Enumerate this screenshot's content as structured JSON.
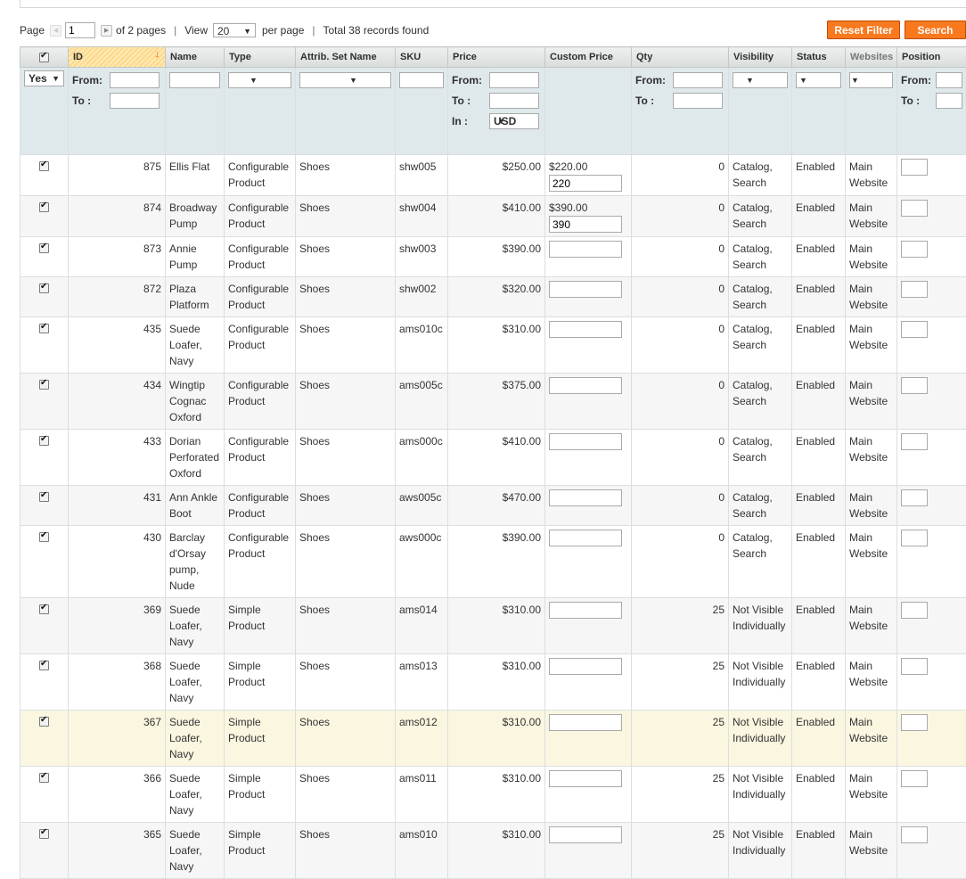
{
  "pager": {
    "page_label": "Page",
    "page_value": "1",
    "of_pages": "of 2 pages",
    "view_label": "View",
    "per_page_value": "20",
    "per_page_label": "per page",
    "total": "Total 38 records found"
  },
  "buttons": {
    "reset": "Reset Filter",
    "search": "Search"
  },
  "columns": [
    "ID",
    "Name",
    "Type",
    "Attrib. Set Name",
    "SKU",
    "Price",
    "Custom Price",
    "Qty",
    "Visibility",
    "Status",
    "Websites",
    "Position"
  ],
  "filter": {
    "in_products": "Yes",
    "from": "From:",
    "to": "To :",
    "in": "In :",
    "currency": "USD"
  },
  "rows": [
    {
      "id": "875",
      "name": "Ellis Flat",
      "type": "Configurable Product",
      "set": "Shoes",
      "sku": "shw005",
      "price": "$250.00",
      "custom_text": "$220.00",
      "custom_value": "220",
      "qty": "0",
      "visibility": "Catalog, Search",
      "status": "Enabled",
      "website": "Main Website"
    },
    {
      "id": "874",
      "name": "Broadway Pump",
      "type": "Configurable Product",
      "set": "Shoes",
      "sku": "shw004",
      "price": "$410.00",
      "custom_text": "$390.00",
      "custom_value": "390",
      "qty": "0",
      "visibility": "Catalog, Search",
      "status": "Enabled",
      "website": "Main Website"
    },
    {
      "id": "873",
      "name": "Annie Pump",
      "type": "Configurable Product",
      "set": "Shoes",
      "sku": "shw003",
      "price": "$390.00",
      "custom_text": "",
      "custom_value": "",
      "qty": "0",
      "visibility": "Catalog, Search",
      "status": "Enabled",
      "website": "Main Website"
    },
    {
      "id": "872",
      "name": "Plaza Platform",
      "type": "Configurable Product",
      "set": "Shoes",
      "sku": "shw002",
      "price": "$320.00",
      "custom_text": "",
      "custom_value": "",
      "qty": "0",
      "visibility": "Catalog, Search",
      "status": "Enabled",
      "website": "Main Website"
    },
    {
      "id": "435",
      "name": "Suede Loafer, Navy",
      "type": "Configurable Product",
      "set": "Shoes",
      "sku": "ams010c",
      "price": "$310.00",
      "custom_text": "",
      "custom_value": "",
      "qty": "0",
      "visibility": "Catalog, Search",
      "status": "Enabled",
      "website": "Main Website"
    },
    {
      "id": "434",
      "name": "Wingtip Cognac Oxford",
      "type": "Configurable Product",
      "set": "Shoes",
      "sku": "ams005c",
      "price": "$375.00",
      "custom_text": "",
      "custom_value": "",
      "qty": "0",
      "visibility": "Catalog, Search",
      "status": "Enabled",
      "website": "Main Website"
    },
    {
      "id": "433",
      "name": "Dorian Perforated Oxford",
      "type": "Configurable Product",
      "set": "Shoes",
      "sku": "ams000c",
      "price": "$410.00",
      "custom_text": "",
      "custom_value": "",
      "qty": "0",
      "visibility": "Catalog, Search",
      "status": "Enabled",
      "website": "Main Website"
    },
    {
      "id": "431",
      "name": "Ann Ankle Boot",
      "type": "Configurable Product",
      "set": "Shoes",
      "sku": "aws005c",
      "price": "$470.00",
      "custom_text": "",
      "custom_value": "",
      "qty": "0",
      "visibility": "Catalog, Search",
      "status": "Enabled",
      "website": "Main Website"
    },
    {
      "id": "430",
      "name": "Barclay d'Orsay pump, Nude",
      "type": "Configurable Product",
      "set": "Shoes",
      "sku": "aws000c",
      "price": "$390.00",
      "custom_text": "",
      "custom_value": "",
      "qty": "0",
      "visibility": "Catalog, Search",
      "status": "Enabled",
      "website": "Main Website"
    },
    {
      "id": "369",
      "name": "Suede Loafer, Navy",
      "type": "Simple Product",
      "set": "Shoes",
      "sku": "ams014",
      "price": "$310.00",
      "custom_text": "",
      "custom_value": "",
      "qty": "25",
      "visibility": "Not Visible Individually",
      "status": "Enabled",
      "website": "Main Website"
    },
    {
      "id": "368",
      "name": "Suede Loafer, Navy",
      "type": "Simple Product",
      "set": "Shoes",
      "sku": "ams013",
      "price": "$310.00",
      "custom_text": "",
      "custom_value": "",
      "qty": "25",
      "visibility": "Not Visible Individually",
      "status": "Enabled",
      "website": "Main Website"
    },
    {
      "id": "367",
      "name": "Suede Loafer, Navy",
      "type": "Simple Product",
      "set": "Shoes",
      "sku": "ams012",
      "price": "$310.00",
      "custom_text": "",
      "custom_value": "",
      "qty": "25",
      "visibility": "Not Visible Individually",
      "status": "Enabled",
      "website": "Main Website"
    },
    {
      "id": "366",
      "name": "Suede Loafer, Navy",
      "type": "Simple Product",
      "set": "Shoes",
      "sku": "ams011",
      "price": "$310.00",
      "custom_text": "",
      "custom_value": "",
      "qty": "25",
      "visibility": "Not Visible Individually",
      "status": "Enabled",
      "website": "Main Website"
    },
    {
      "id": "365",
      "name": "Suede Loafer, Navy",
      "type": "Simple Product",
      "set": "Shoes",
      "sku": "ams010",
      "price": "$310.00",
      "custom_text": "",
      "custom_value": "",
      "qty": "25",
      "visibility": "Not Visible Individually",
      "status": "Enabled",
      "website": "Main Website"
    }
  ],
  "colors": {
    "accent": "#f8791e",
    "header_bg": "#e1e4e3",
    "filter_bg": "#dfe9ec",
    "row_alt": "#f6f6f6",
    "row_highlight": "#faf6e0"
  }
}
